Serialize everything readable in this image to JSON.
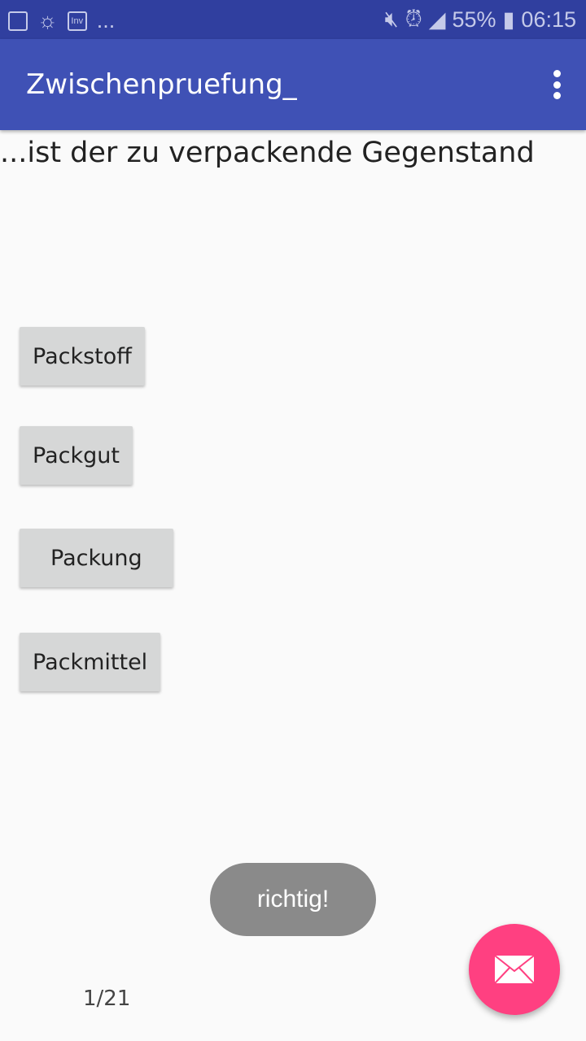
{
  "status_bar": {
    "battery": "55%",
    "time": "06:15",
    "more": "...",
    "inv_label": "Inv"
  },
  "app_bar": {
    "title": "Zwischenpruefung_"
  },
  "question": "...ist der zu verpackende Gegenstand",
  "answers": [
    "Packstoff",
    "Packgut",
    "Packung",
    "Packmittel"
  ],
  "toast": "richtig!",
  "counter": "1/21",
  "colors": {
    "primary": "#3f51b5",
    "primary_dark": "#303f9f",
    "accent": "#ff4081"
  }
}
